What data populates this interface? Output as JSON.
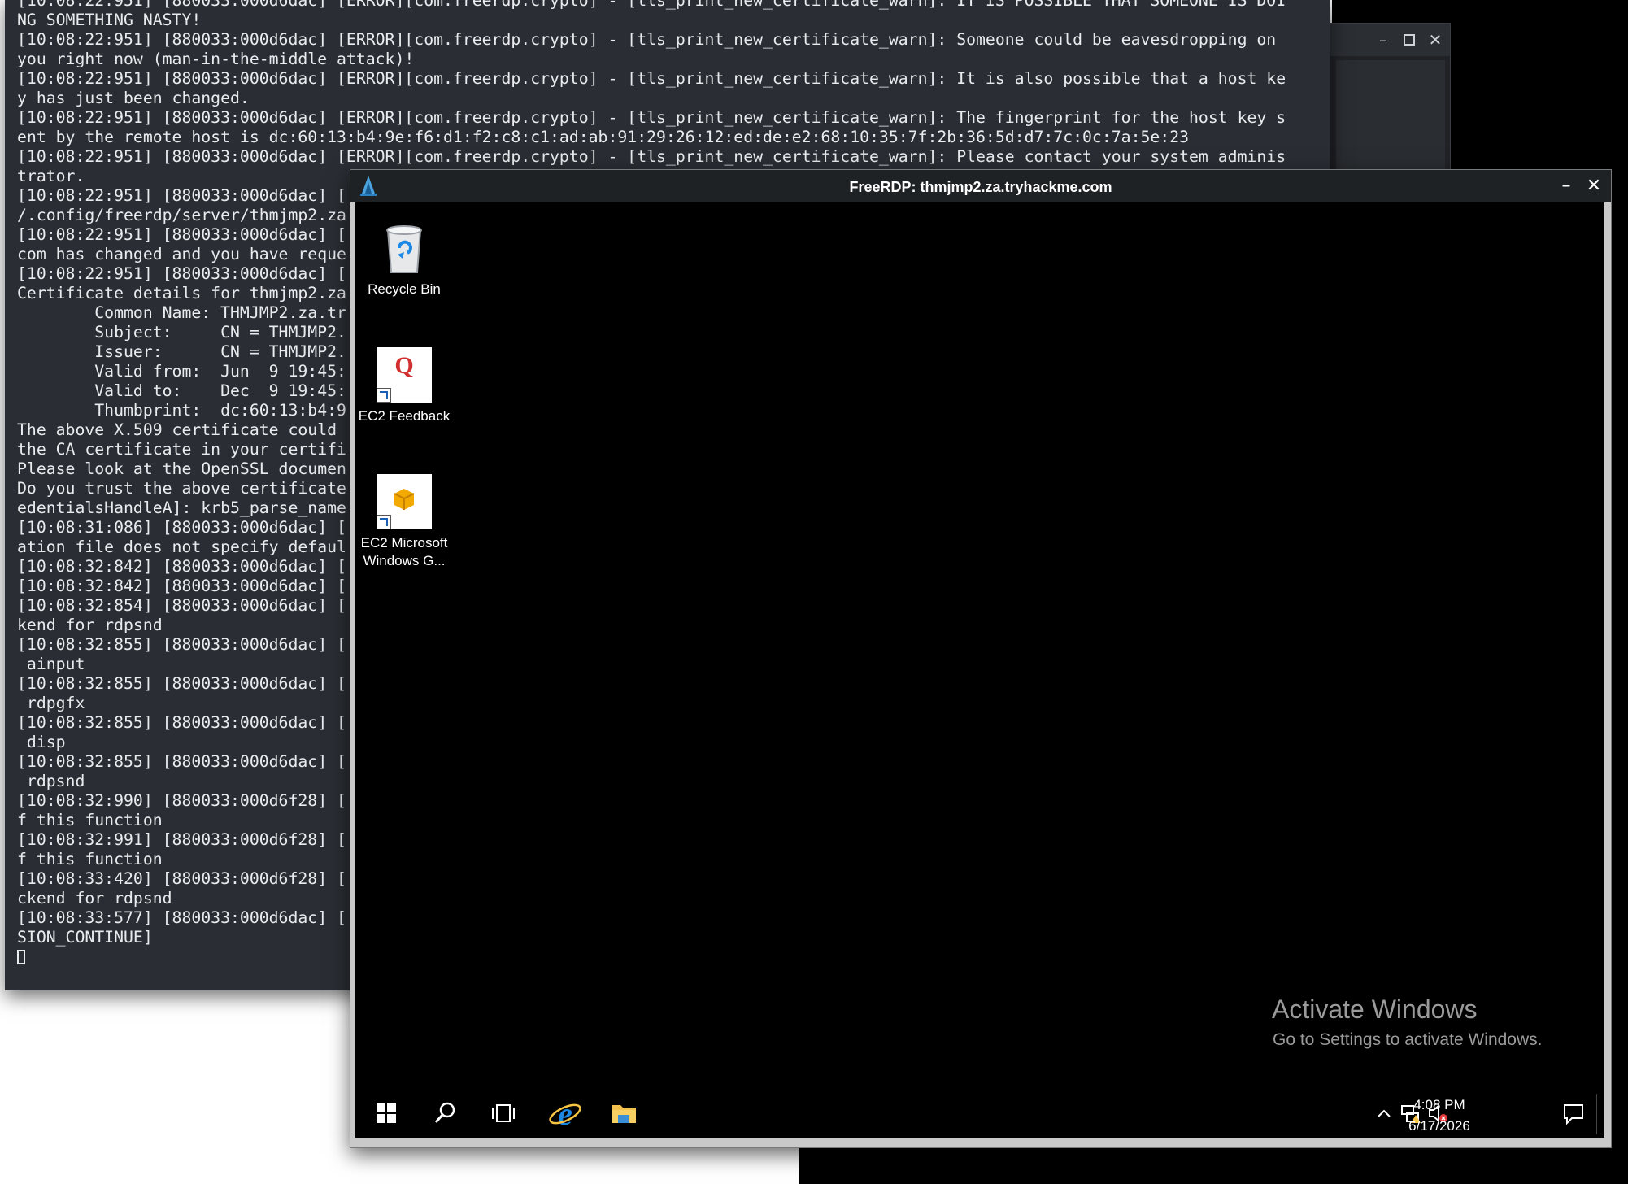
{
  "terminal": {
    "lines": [
      "[10:08:22:951] [880033:000d6dac] [ERROR][com.freerdp.crypto] - [tls_print_new_certificate_warn]: IT IS POSSIBLE THAT SOMEONE IS DOI",
      "NG SOMETHING NASTY!",
      "[10:08:22:951] [880033:000d6dac] [ERROR][com.freerdp.crypto] - [tls_print_new_certificate_warn]: Someone could be eavesdropping on",
      "you right now (man-in-the-middle attack)!",
      "[10:08:22:951] [880033:000d6dac] [ERROR][com.freerdp.crypto] - [tls_print_new_certificate_warn]: It is also possible that a host ke",
      "y has just been changed.",
      "[10:08:22:951] [880033:000d6dac] [ERROR][com.freerdp.crypto] - [tls_print_new_certificate_warn]: The fingerprint for the host key s",
      "ent by the remote host is dc:60:13:b4:9e:f6:d1:f2:c8:c1:ad:ab:91:29:26:12:ed:de:e2:68:10:35:7f:2b:36:5d:d7:7c:0c:7a:5e:23",
      "[10:08:22:951] [880033:000d6dac] [ERROR][com.freerdp.crypto] - [tls_print_new_certificate_warn]: Please contact your system adminis",
      "trator.",
      "[10:08:22:951] [880033:000d6dac] [",
      "/.config/freerdp/server/thmjmp2.za",
      "[10:08:22:951] [880033:000d6dac] [",
      "com has changed and you have reque",
      "[10:08:22:951] [880033:000d6dac] [",
      "Certificate details for thmjmp2.za",
      "        Common Name: THMJMP2.za.tr",
      "        Subject:     CN = THMJMP2.",
      "        Issuer:      CN = THMJMP2.",
      "        Valid from:  Jun  9 19:45:",
      "        Valid to:    Dec  9 19:45:",
      "        Thumbprint:  dc:60:13:b4:9",
      "The above X.509 certificate could",
      "the CA certificate in your certifi",
      "Please look at the OpenSSL documen",
      "Do you trust the above certificate",
      "edentialsHandleA]: krb5_parse_name",
      "[10:08:31:086] [880033:000d6dac] [",
      "ation file does not specify defaul",
      "[10:08:32:842] [880033:000d6dac] [",
      "[10:08:32:842] [880033:000d6dac] [",
      "[10:08:32:854] [880033:000d6dac] [",
      "kend for rdpsnd",
      "[10:08:32:855] [880033:000d6dac] [",
      " ainput",
      "[10:08:32:855] [880033:000d6dac] [",
      " rdpgfx",
      "[10:08:32:855] [880033:000d6dac] [",
      " disp",
      "[10:08:32:855] [880033:000d6dac] [",
      " rdpsnd",
      "[10:08:32:990] [880033:000d6f28] [",
      "f this function",
      "[10:08:32:991] [880033:000d6f28] [",
      "f this function",
      "[10:08:33:420] [880033:000d6f28] [",
      "ckend for rdpsnd",
      "[10:08:33:577] [880033:000d6dac] [",
      "SION_CONTINUE]"
    ]
  },
  "rdp": {
    "title": "FreeRDP: thmjmp2.za.tryhackme.com",
    "desktop_icons": [
      {
        "label": "Recycle Bin"
      },
      {
        "label": "EC2 Feedback"
      },
      {
        "label": "EC2 Microsoft Windows G..."
      }
    ],
    "watermark_title": "Activate Windows",
    "watermark_sub": "Go to Settings to activate Windows.",
    "clock_time": "4:08 PM",
    "clock_date": "6/17/2026"
  },
  "colors": {
    "terminal_bg": "#2a2e34",
    "terminal_text": "#e9ebee",
    "desktop_bg": "#000000"
  }
}
